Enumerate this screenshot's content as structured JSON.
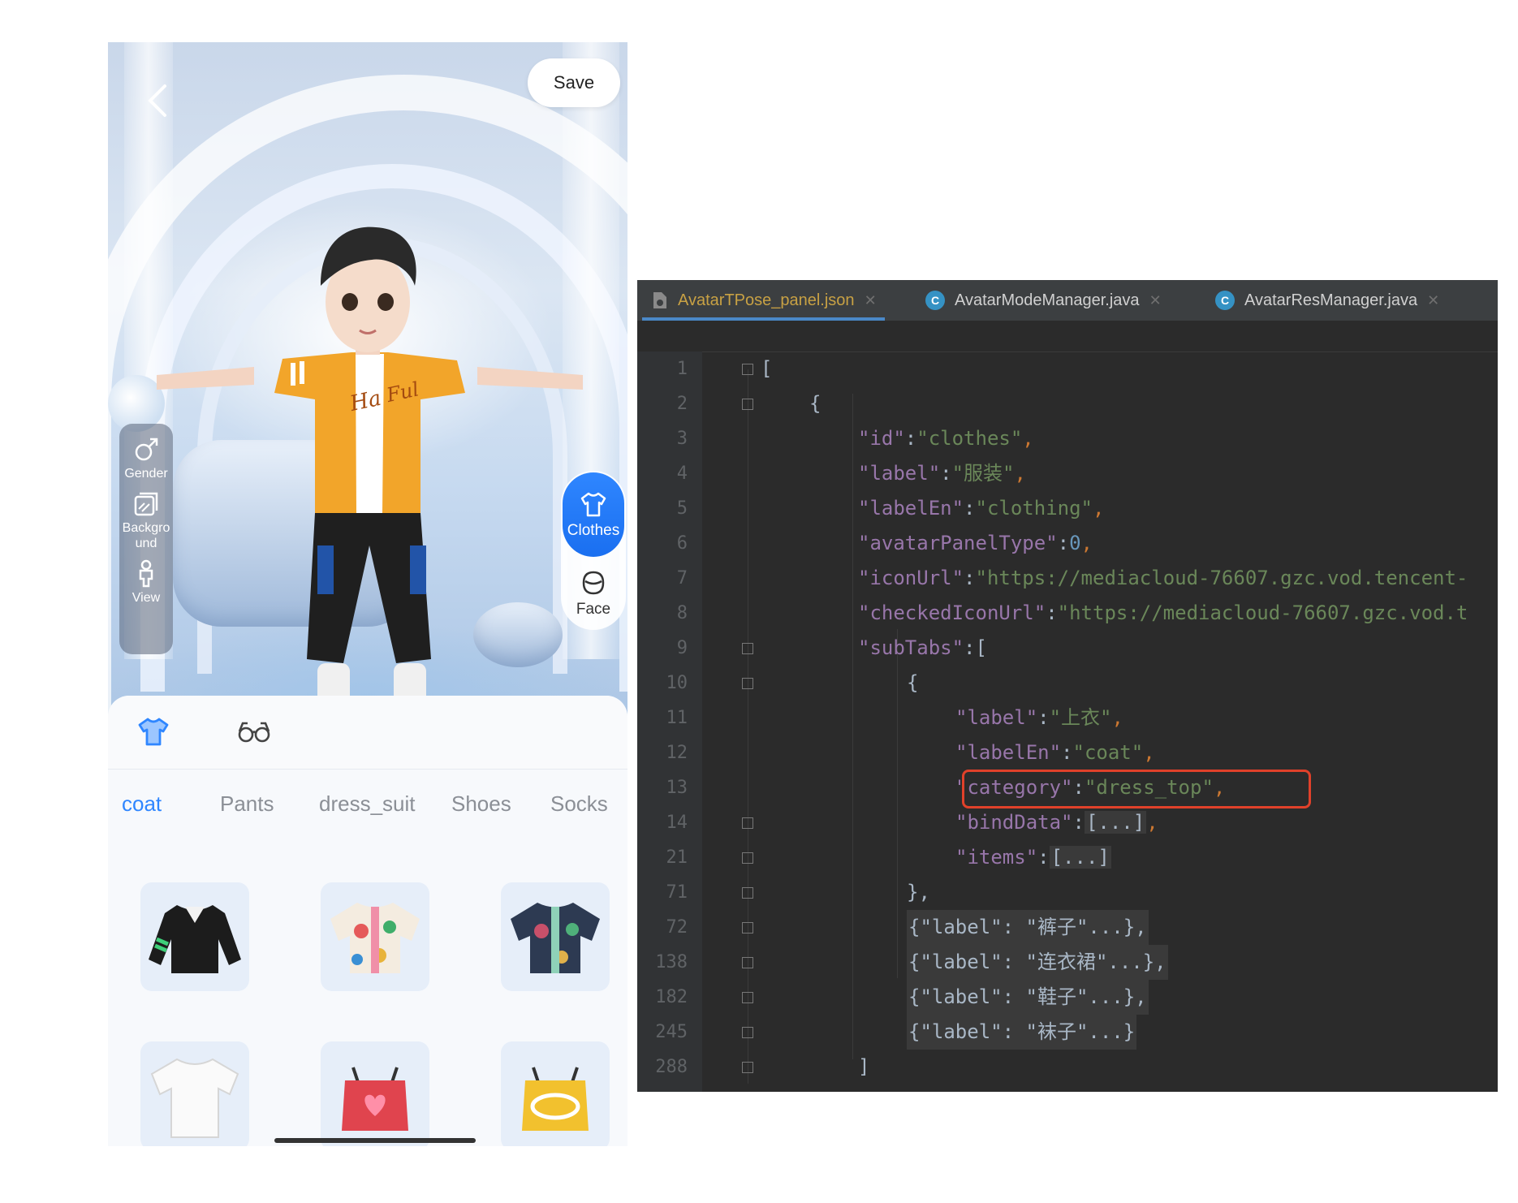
{
  "phone": {
    "save_label": "Save",
    "left_rail": [
      {
        "label": "Gender",
        "icon": "male-icon"
      },
      {
        "label": "Backgro\nund",
        "icon": "background-icon"
      },
      {
        "label": "View",
        "icon": "person-icon"
      }
    ],
    "right_rail": [
      {
        "label": "Clothes",
        "icon": "shirt-icon",
        "active": true
      },
      {
        "label": "Face",
        "icon": "face-icon",
        "active": false
      }
    ],
    "category_icons": [
      "shirt-icon",
      "glasses-icon"
    ],
    "sub_tabs": [
      {
        "label": "coat",
        "active": true
      },
      {
        "label": "Pants",
        "active": false
      },
      {
        "label": "dress_suit",
        "active": false
      },
      {
        "label": "Shoes",
        "active": false
      },
      {
        "label": "Socks",
        "active": false
      }
    ],
    "accent_color": "#2f86ff"
  },
  "editor": {
    "tabs": [
      {
        "label": "AvatarTPose_panel.json",
        "active": true,
        "icon": "json-file-icon"
      },
      {
        "label": "AvatarModeManager.java",
        "active": false,
        "icon": "class-icon"
      },
      {
        "label": "AvatarResManager.java",
        "active": false,
        "icon": "class-icon"
      }
    ],
    "lines": [
      {
        "n": "1",
        "text": "["
      },
      {
        "n": "2",
        "text": "{"
      },
      {
        "n": "3",
        "key": "\"id\"",
        "val": "\"clothes\""
      },
      {
        "n": "4",
        "key": "\"label\"",
        "val": "\"服装\""
      },
      {
        "n": "5",
        "key": "\"labelEn\"",
        "val": "\"clothing\""
      },
      {
        "n": "6",
        "key": "\"avatarPanelType\"",
        "val": "0"
      },
      {
        "n": "7",
        "key": "\"iconUrl\"",
        "val": "\"https://mediacloud-76607.gzc.vod.tencent-"
      },
      {
        "n": "8",
        "key": "\"checkedIconUrl\"",
        "val": "\"https://mediacloud-76607.gzc.vod.t"
      },
      {
        "n": "9",
        "key": "\"subTabs\"",
        "val": "["
      },
      {
        "n": "10",
        "text": "{"
      },
      {
        "n": "11",
        "key": "\"label\"",
        "val": "\"上衣\""
      },
      {
        "n": "12",
        "key": "\"labelEn\"",
        "val": "\"coat\""
      },
      {
        "n": "13",
        "key": "\"category\"",
        "val": "\"dress_top\""
      },
      {
        "n": "14",
        "key": "\"bindData\"",
        "val": "[...]"
      },
      {
        "n": "21",
        "key": "\"items\"",
        "val": "[...]"
      },
      {
        "n": "71",
        "text": "},"
      },
      {
        "n": "72",
        "text": "{\"label\": \"裤子\"...},"
      },
      {
        "n": "138",
        "text": "{\"label\": \"连衣裙\"...},"
      },
      {
        "n": "182",
        "text": "{\"label\": \"鞋子\"...},"
      },
      {
        "n": "245",
        "text": "{\"label\": \"袜子\"...}"
      },
      {
        "n": "288",
        "text": "]"
      }
    ]
  }
}
